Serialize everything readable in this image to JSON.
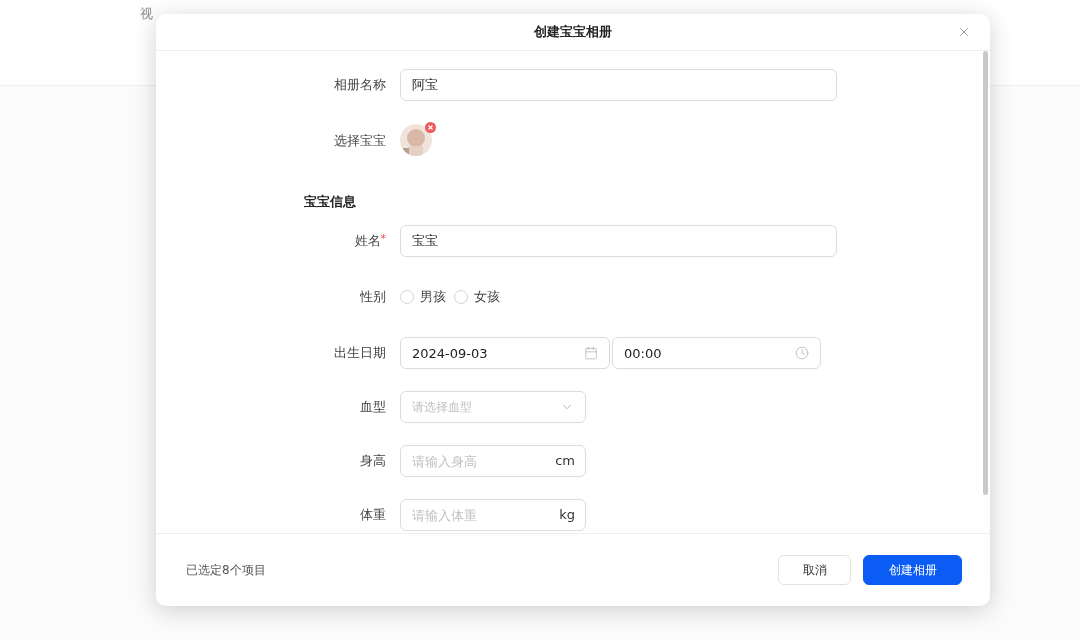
{
  "background_nav": [
    {
      "label": "视"
    }
  ],
  "dialog": {
    "title": "创建宝宝相册",
    "fields": [
      {
        "kind": "text",
        "label": "相册名称",
        "value": "阿宝"
      },
      {
        "kind": "avatar",
        "label": "选择宝宝"
      },
      {
        "kind": "section",
        "label": "宝宝信息"
      },
      {
        "kind": "text",
        "label": "姓名",
        "required_mark": "*",
        "value": "宝宝"
      },
      {
        "kind": "radio",
        "label": "性别",
        "options": [
          {
            "label": "男孩",
            "selected": false
          },
          {
            "label": "女孩",
            "selected": false
          }
        ]
      },
      {
        "kind": "datetime",
        "label": "出生日期",
        "date": "2024-09-03",
        "time": "00:00"
      },
      {
        "kind": "select",
        "label": "血型",
        "placeholder": "请选择血型"
      },
      {
        "kind": "unit",
        "label": "身高",
        "placeholder": "请输入身高",
        "unit": "cm"
      },
      {
        "kind": "unit",
        "label": "体重",
        "placeholder": "请输入体重",
        "unit": "kg"
      }
    ],
    "footer": {
      "status": "已选定8个项目",
      "buttons": [
        {
          "label": "取消",
          "kind": "secondary"
        },
        {
          "label": "创建相册",
          "kind": "primary"
        }
      ]
    }
  }
}
